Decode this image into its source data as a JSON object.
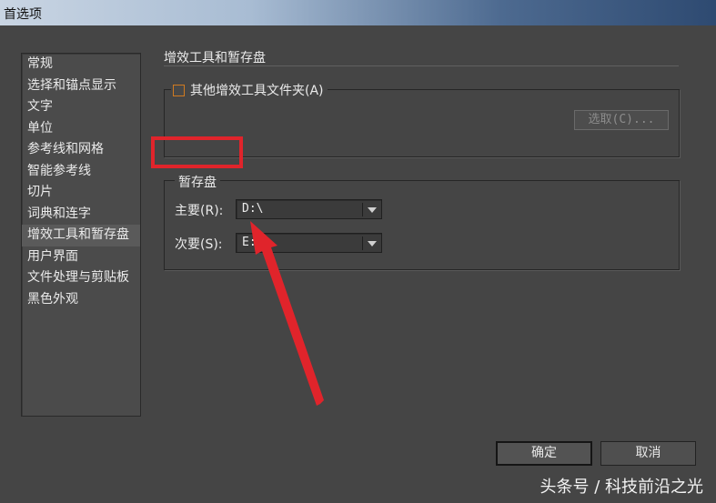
{
  "window": {
    "title": "首选项"
  },
  "sidebar": {
    "items": [
      {
        "label": "常规",
        "selected": false
      },
      {
        "label": "选择和锚点显示",
        "selected": false
      },
      {
        "label": "文字",
        "selected": false
      },
      {
        "label": "单位",
        "selected": false
      },
      {
        "label": "参考线和网格",
        "selected": false
      },
      {
        "label": "智能参考线",
        "selected": false
      },
      {
        "label": "切片",
        "selected": false
      },
      {
        "label": "词典和连字",
        "selected": false
      },
      {
        "label": "增效工具和暂存盘",
        "selected": true
      },
      {
        "label": "用户界面",
        "selected": false
      },
      {
        "label": "文件处理与剪贴板",
        "selected": false
      },
      {
        "label": "黑色外观",
        "selected": false
      }
    ]
  },
  "panel": {
    "title": "增效工具和暂存盘",
    "plugins": {
      "checkbox_label": "其他增效工具文件夹(A)",
      "checked": false,
      "choose_button": "选取(C)..."
    },
    "scratch": {
      "legend": "暂存盘",
      "primary_label": "主要(R):",
      "primary_value": "D:\\",
      "secondary_label": "次要(S):",
      "secondary_value": "E:"
    }
  },
  "buttons": {
    "ok": "确定",
    "cancel": "取消"
  },
  "watermark": "头条号 / 科技前沿之光",
  "colors": {
    "annotation_red": "#e0242b",
    "checkbox_orange": "#d07a20",
    "dialog_bg": "#454545"
  }
}
